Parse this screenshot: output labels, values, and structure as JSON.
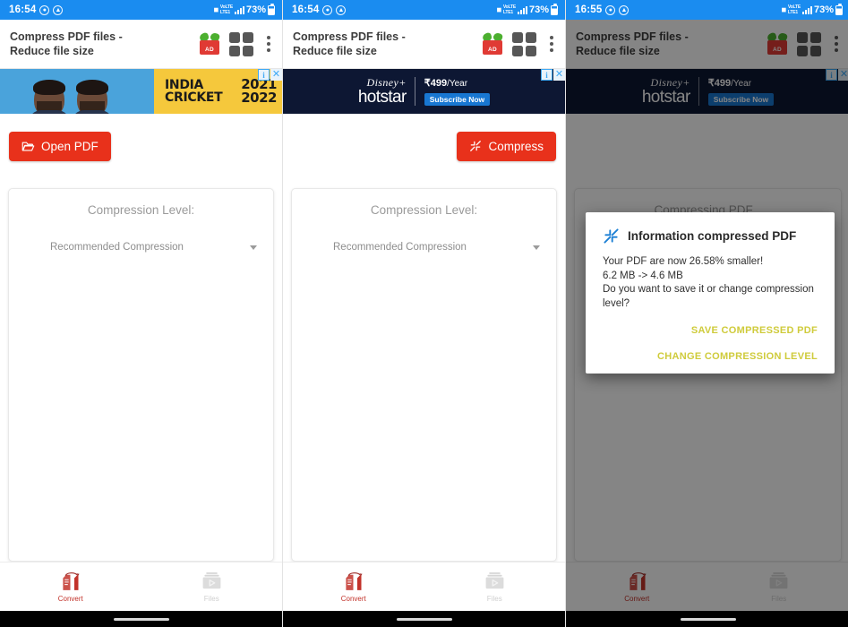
{
  "panels": [
    {
      "id": "panel-1",
      "status": {
        "time": "16:54",
        "battery": "73%",
        "network": "LTE",
        "icons": [
          "dnd-icon",
          "data-saver-icon",
          "wifi-icon",
          "signal-icon",
          "battery-icon"
        ]
      },
      "toolbar": {
        "title": "Compress PDF files - Reduce file size",
        "ad_badge": "AD",
        "grid_label": "apps-grid",
        "menu_label": "more-options"
      },
      "ad": {
        "type": "cricket",
        "brand_line1": "INDIA",
        "brand_line2": "CRICKET",
        "year_line1": "2021",
        "year_line2": "2022",
        "info_glyph": "i",
        "close_glyph": "✕"
      },
      "actions": {
        "primary_label": "Open PDF",
        "primary_icon": "open-folder-icon",
        "show_compress": false
      },
      "card": {
        "title": "Compression Level:",
        "level_value": "Recommended Compression"
      },
      "nav": [
        {
          "label": "Convert",
          "icon": "convert-pdf-icon",
          "active": true
        },
        {
          "label": "Files",
          "icon": "files-icon",
          "active": false
        }
      ]
    },
    {
      "id": "panel-2",
      "status": {
        "time": "16:54",
        "battery": "73%",
        "network": "LTE"
      },
      "toolbar": {
        "title": "Compress PDF files - Reduce file size",
        "ad_badge": "AD"
      },
      "ad": {
        "type": "hotstar",
        "brand_line1": "Disney+",
        "brand_line2": "hotstar",
        "price": "₹499",
        "price_suffix": "/Year",
        "cta": "Subscribe Now",
        "info_glyph": "i",
        "close_glyph": "✕"
      },
      "actions": {
        "primary_label": "Compress",
        "primary_icon": "compress-icon",
        "show_compress": true
      },
      "card": {
        "title": "Compression Level:",
        "level_value": "Recommended Compression"
      },
      "nav": [
        {
          "label": "Convert",
          "icon": "convert-pdf-icon",
          "active": true
        },
        {
          "label": "Files",
          "icon": "files-icon",
          "active": false
        }
      ]
    },
    {
      "id": "panel-3",
      "status": {
        "time": "16:55",
        "battery": "73%",
        "network": "LTE"
      },
      "toolbar": {
        "title": "Compress PDF files - Reduce file size",
        "ad_badge": "AD"
      },
      "ad": {
        "type": "hotstar",
        "brand_line1": "Disney+",
        "brand_line2": "hotstar",
        "price": "₹499",
        "price_suffix": "/Year",
        "cta": "Subscribe Now",
        "info_glyph": "i",
        "close_glyph": "✕"
      },
      "actions": {
        "show_compress": false
      },
      "card": {
        "title": "Compressing PDF...",
        "level_value": ""
      },
      "dialog": {
        "icon": "compress-arrows-icon",
        "title": "Information compressed PDF",
        "body": "Your PDF are now 26.58% smaller!\n6.2 MB -> 4.6 MB\nDo you want to save it or change compression level?",
        "buttons": [
          {
            "label": "SAVE COMPRESSED PDF"
          },
          {
            "label": "CHANGE COMPRESSION LEVEL"
          }
        ]
      },
      "nav": [
        {
          "label": "Convert",
          "icon": "convert-pdf-icon",
          "active": true
        },
        {
          "label": "Files",
          "icon": "files-icon",
          "active": false
        }
      ]
    }
  ],
  "colors": {
    "status_bar": "#1a8cf0",
    "accent_red": "#e8311b",
    "dialog_action": "#cfcb3b",
    "nav_active": "#c2322a",
    "nav_idle": "#cfcfcf"
  }
}
